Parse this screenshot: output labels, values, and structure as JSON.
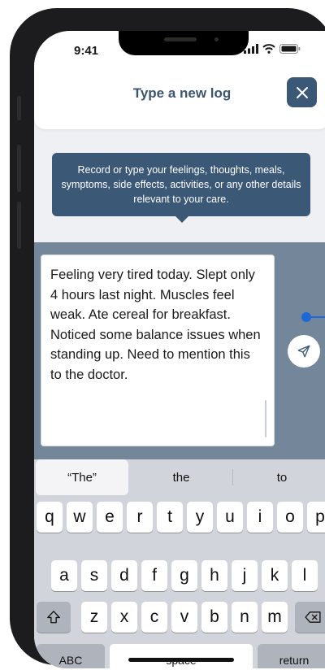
{
  "status_bar": {
    "time": "9:41"
  },
  "header": {
    "title": "Type a new log",
    "close_icon": "close-icon"
  },
  "tooltip": {
    "text": "Record or type your feelings, thoughts, meals, symptoms, side effects, activities, or any other details relevant to your care."
  },
  "compose": {
    "text": "Feeling very tired today. Slept only 4 hours last night. Muscles feel weak. Ate cereal for breakfast. Noticed some balance issues when standing up. Need to mention this to the doctor.",
    "send_icon": "send-icon"
  },
  "keyboard": {
    "suggestions": [
      "“The”",
      "the",
      "to"
    ],
    "row1": [
      "q",
      "w",
      "e",
      "r",
      "t",
      "y",
      "u",
      "i",
      "o",
      "p"
    ],
    "row2": [
      "a",
      "s",
      "d",
      "f",
      "g",
      "h",
      "j",
      "k",
      "l"
    ],
    "row3": [
      "z",
      "x",
      "c",
      "v",
      "b",
      "n",
      "m"
    ],
    "shift_icon": "shift-icon",
    "backspace_icon": "backspace-icon",
    "abc_label": "ABC",
    "space_label": "space",
    "return_label": "return"
  },
  "colors": {
    "accent": "#3b5877",
    "compose_bg": "#74869a",
    "connector": "#1d68d6"
  }
}
